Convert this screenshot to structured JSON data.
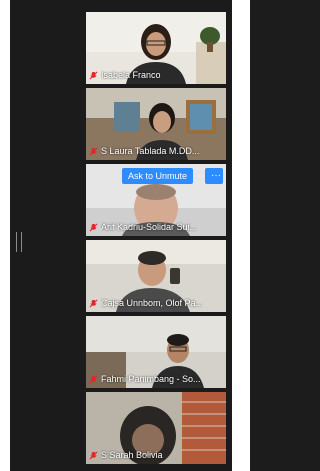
{
  "participants": [
    {
      "name": "Isabela Franco",
      "muted": true
    },
    {
      "name": "S Laura Tablada M.DD...",
      "muted": true
    },
    {
      "name": "Arif Kadriu-Solidar Sui...",
      "muted": true
    },
    {
      "name": "Cajsa Unnbom, Olof Pa...",
      "muted": true
    },
    {
      "name": "Fahmi Panimbang - So...",
      "muted": true
    },
    {
      "name": "S Sarah Bolivia",
      "muted": true
    }
  ],
  "controls": {
    "ask_to_unmute": "Ask to Unmute",
    "more": "···"
  },
  "colors": {
    "accent": "#2d8cff",
    "muted_icon": "#e02828"
  },
  "icons": {
    "mic_muted": "mic-muted-icon",
    "splitter": "panel-resize-handle-icon"
  }
}
